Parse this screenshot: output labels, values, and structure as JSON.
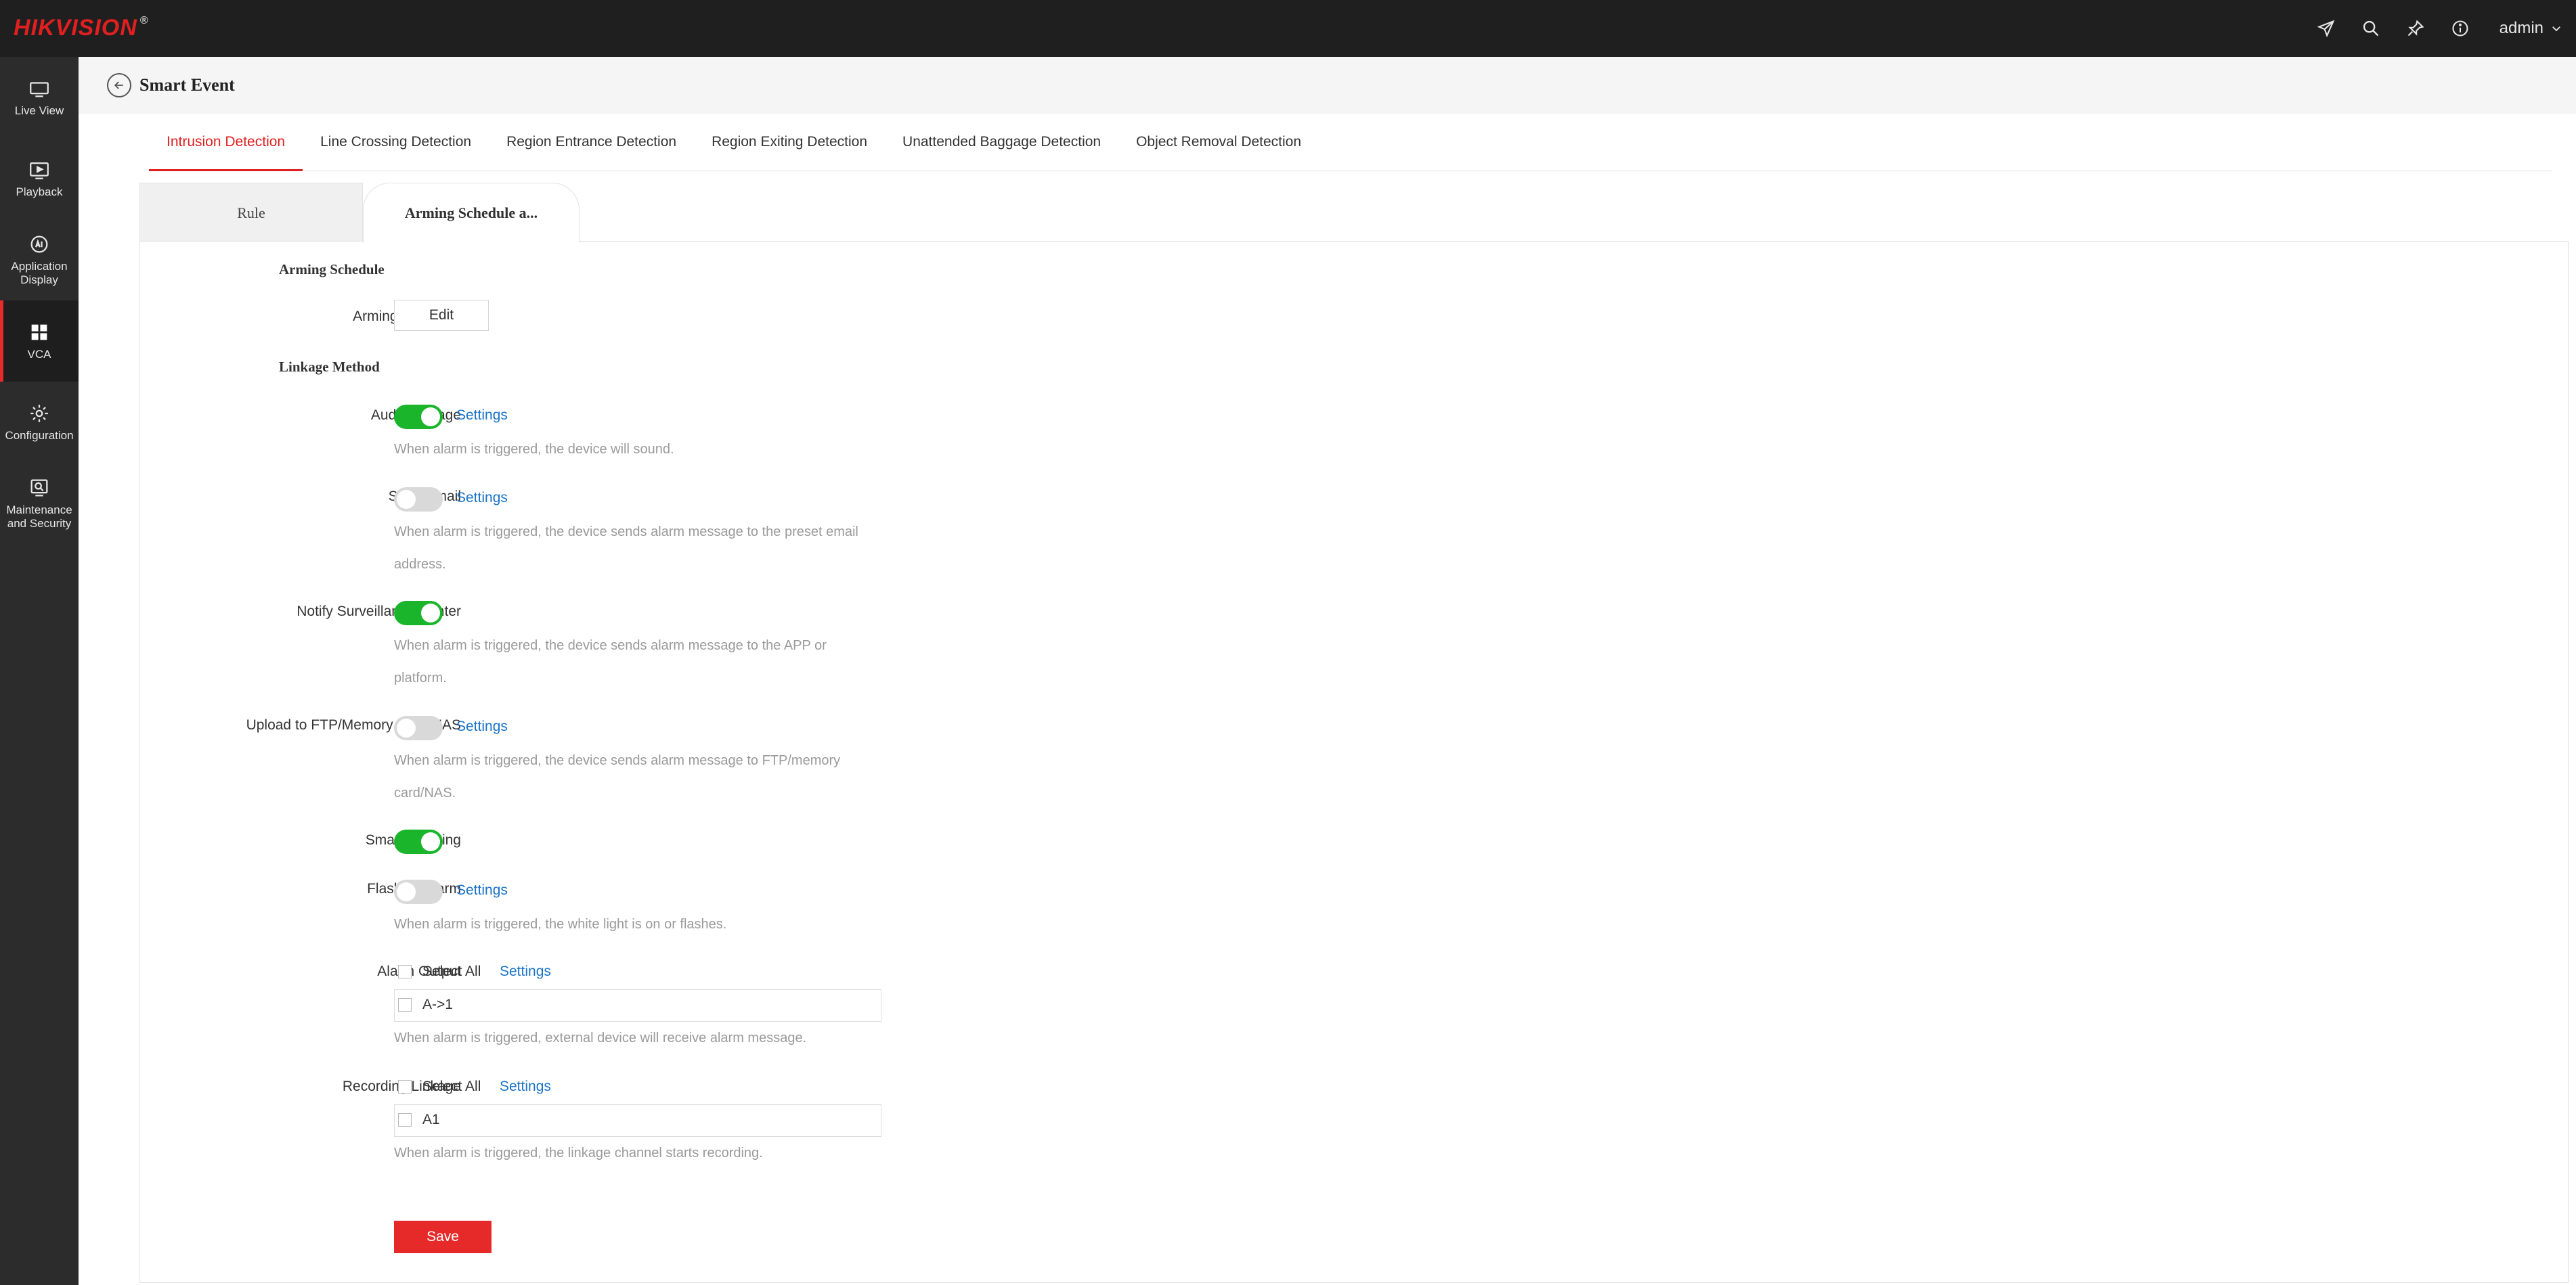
{
  "brand": {
    "name": "HIKVISION",
    "mark": "®"
  },
  "header": {
    "user": "admin"
  },
  "sidebar": {
    "items": [
      {
        "label": "Live View"
      },
      {
        "label": "Playback"
      },
      {
        "label": "Application Display"
      },
      {
        "label": "VCA"
      },
      {
        "label": "Configuration"
      },
      {
        "label": "Maintenance and Security"
      }
    ],
    "active": "VCA"
  },
  "page": {
    "title": "Smart Event"
  },
  "tabs": [
    "Intrusion Detection",
    "Line Crossing Detection",
    "Region Entrance Detection",
    "Region Exiting Detection",
    "Unattended Baggage Detection",
    "Object Removal Detection"
  ],
  "active_tab": "Intrusion Detection",
  "subtabs": {
    "rule": "Rule",
    "arming": "Arming Schedule a..."
  },
  "form": {
    "arming_section": "Arming Schedule",
    "arming_label": "Arming Schedule",
    "edit_label": "Edit",
    "linkage_section": "Linkage Method",
    "settings_label": "Settings",
    "audio_label": "Audio Linkage",
    "audio_hint": "When alarm is triggered, the device will sound.",
    "email_label": "Send Email",
    "email_hint": "When alarm is triggered, the device sends alarm message to the preset email address.",
    "notify_label": "Notify Surveillance Center",
    "notify_hint": "When alarm is triggered, the device sends alarm message to the APP or platform.",
    "ftp_label": "Upload to FTP/Memory Card/NAS",
    "ftp_hint": "When alarm is triggered, the device sends alarm message to FTP/memory card/NAS.",
    "tracking_label": "Smart Tracking",
    "flash_label": "Flashing Alarm",
    "flash_hint": "When alarm is triggered, the white light is on or flashes.",
    "alarm_output_label": "Alarm Output",
    "select_all": "Select All",
    "alarm_output_item": "A->1",
    "alarm_output_hint": "When alarm is triggered, external device will receive alarm message.",
    "recording_label": "Recording Linkage",
    "recording_item": "A1",
    "recording_hint": "When alarm is triggered, the linkage channel starts recording.",
    "save_label": "Save"
  },
  "toggles": {
    "audio": true,
    "email": false,
    "notify": true,
    "ftp": false,
    "tracking": true,
    "flash": false
  },
  "colors": {
    "accent": "#e02020",
    "toggle_on": "#1ab52a",
    "link": "#1a73c8",
    "save": "#e62a2a"
  }
}
